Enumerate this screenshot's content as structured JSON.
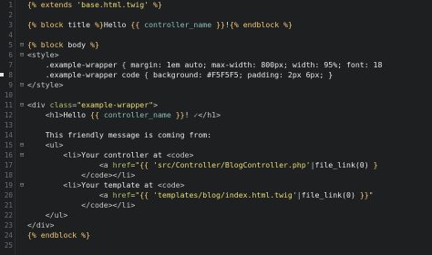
{
  "editor": {
    "lines": [
      {
        "n": "1",
        "fold": "",
        "marker": false,
        "tokens": [
          {
            "t": "{% ",
            "c": "t-bracket"
          },
          {
            "t": "extends ",
            "c": "t-keyword"
          },
          {
            "t": "'base.html.twig'",
            "c": "t-str"
          },
          {
            "t": " %}",
            "c": "t-bracket"
          }
        ]
      },
      {
        "n": "2",
        "fold": "",
        "marker": false,
        "tokens": []
      },
      {
        "n": "3",
        "fold": "",
        "marker": false,
        "tokens": [
          {
            "t": "{% ",
            "c": "t-bracket"
          },
          {
            "t": "block ",
            "c": "t-keyword"
          },
          {
            "t": "title",
            "c": "t-text"
          },
          {
            "t": " %}",
            "c": "t-bracket"
          },
          {
            "t": "Hello ",
            "c": "t-text"
          },
          {
            "t": "{{ ",
            "c": "t-bracket"
          },
          {
            "t": "controller_name",
            "c": "t-var"
          },
          {
            "t": " }}",
            "c": "t-bracket"
          },
          {
            "t": "!",
            "c": "t-text"
          },
          {
            "t": "{% ",
            "c": "t-bracket"
          },
          {
            "t": "endblock",
            "c": "t-keyword"
          },
          {
            "t": " %}",
            "c": "t-bracket"
          }
        ]
      },
      {
        "n": "4",
        "fold": "",
        "marker": false,
        "tokens": []
      },
      {
        "n": "5",
        "fold": "⊟",
        "marker": false,
        "tokens": [
          {
            "t": "{% ",
            "c": "t-bracket"
          },
          {
            "t": "block ",
            "c": "t-keyword"
          },
          {
            "t": "body",
            "c": "t-text"
          },
          {
            "t": " %}",
            "c": "t-bracket"
          }
        ]
      },
      {
        "n": "6",
        "fold": "⊟",
        "marker": false,
        "tokens": [
          {
            "t": "<style>",
            "c": "t-tag"
          }
        ]
      },
      {
        "n": "7",
        "fold": "",
        "marker": false,
        "tokens": [
          {
            "t": "    .example-wrapper ",
            "c": "t-sel"
          },
          {
            "t": "{ ",
            "c": "t-punc"
          },
          {
            "t": "margin: 1em auto; max-width: 800px; width: 95%; font: 18",
            "c": "t-prop"
          }
        ]
      },
      {
        "n": "8",
        "fold": "",
        "marker": true,
        "tokens": [
          {
            "t": "    .example-wrapper code ",
            "c": "t-sel"
          },
          {
            "t": "{ ",
            "c": "t-punc"
          },
          {
            "t": "background: #F5F5F5; padding: 2px 6px; }",
            "c": "t-prop"
          }
        ]
      },
      {
        "n": "9",
        "fold": "⊟",
        "marker": false,
        "tokens": [
          {
            "t": "</style>",
            "c": "t-tag"
          }
        ]
      },
      {
        "n": "10",
        "fold": "",
        "marker": false,
        "tokens": []
      },
      {
        "n": "11",
        "fold": "⊟",
        "marker": false,
        "tokens": [
          {
            "t": "<div ",
            "c": "t-tag"
          },
          {
            "t": "class",
            "c": "t-attr"
          },
          {
            "t": "=",
            "c": "t-punc"
          },
          {
            "t": "\"example-wrapper\"",
            "c": "t-str"
          },
          {
            "t": ">",
            "c": "t-tag"
          }
        ]
      },
      {
        "n": "12",
        "fold": "",
        "marker": false,
        "tokens": [
          {
            "t": "    <h1>",
            "c": "t-tag"
          },
          {
            "t": "Hello ",
            "c": "t-text"
          },
          {
            "t": "{{ ",
            "c": "t-bracket"
          },
          {
            "t": "controller_name",
            "c": "t-var"
          },
          {
            "t": " }}",
            "c": "t-bracket"
          },
          {
            "t": "! ",
            "c": "t-text"
          },
          {
            "t": "✓",
            "c": "t-cursor"
          },
          {
            "t": "</h1>",
            "c": "t-tag"
          }
        ]
      },
      {
        "n": "13",
        "fold": "",
        "marker": false,
        "tokens": []
      },
      {
        "n": "14",
        "fold": "",
        "marker": false,
        "tokens": [
          {
            "t": "    This friendly message is coming from:",
            "c": "t-text"
          }
        ]
      },
      {
        "n": "15",
        "fold": "⊟",
        "marker": false,
        "tokens": [
          {
            "t": "    <ul>",
            "c": "t-tag"
          }
        ]
      },
      {
        "n": "16",
        "fold": "⊟",
        "marker": false,
        "tokens": [
          {
            "t": "        <li>",
            "c": "t-tag"
          },
          {
            "t": "Your controller at ",
            "c": "t-text"
          },
          {
            "t": "<code>",
            "c": "t-tag"
          }
        ]
      },
      {
        "n": "17",
        "fold": "",
        "marker": false,
        "tokens": [
          {
            "t": "                <a ",
            "c": "t-tag"
          },
          {
            "t": "href",
            "c": "t-attr"
          },
          {
            "t": "=\"",
            "c": "t-str"
          },
          {
            "t": "{{ ",
            "c": "t-bracket"
          },
          {
            "t": "'src/Controller/BlogController.php'",
            "c": "t-str"
          },
          {
            "t": "|",
            "c": "t-punc"
          },
          {
            "t": "file_link(0)",
            "c": "t-text"
          },
          {
            "t": " }",
            "c": "t-bracket"
          }
        ]
      },
      {
        "n": "18",
        "fold": "",
        "marker": false,
        "tokens": [
          {
            "t": "            </code>",
            "c": "t-tag"
          },
          {
            "t": "</li>",
            "c": "t-tag"
          }
        ]
      },
      {
        "n": "19",
        "fold": "⊟",
        "marker": false,
        "tokens": [
          {
            "t": "        <li>",
            "c": "t-tag"
          },
          {
            "t": "Your template at ",
            "c": "t-text"
          },
          {
            "t": "<code>",
            "c": "t-tag"
          }
        ]
      },
      {
        "n": "20",
        "fold": "",
        "marker": false,
        "tokens": [
          {
            "t": "                <a ",
            "c": "t-tag"
          },
          {
            "t": "href",
            "c": "t-attr"
          },
          {
            "t": "=\"",
            "c": "t-str"
          },
          {
            "t": "{{ ",
            "c": "t-bracket"
          },
          {
            "t": "'templates/blog/index.html.twig'",
            "c": "t-str"
          },
          {
            "t": "|",
            "c": "t-punc"
          },
          {
            "t": "file_link(0)",
            "c": "t-text"
          },
          {
            "t": " }}\"",
            "c": "t-bracket"
          }
        ]
      },
      {
        "n": "21",
        "fold": "",
        "marker": false,
        "tokens": [
          {
            "t": "            </code>",
            "c": "t-tag"
          },
          {
            "t": "</li>",
            "c": "t-tag"
          }
        ]
      },
      {
        "n": "22",
        "fold": "",
        "marker": false,
        "tokens": [
          {
            "t": "    </ul>",
            "c": "t-tag"
          }
        ]
      },
      {
        "n": "23",
        "fold": "",
        "marker": false,
        "tokens": [
          {
            "t": "</div>",
            "c": "t-tag"
          }
        ]
      },
      {
        "n": "24",
        "fold": "",
        "marker": false,
        "tokens": [
          {
            "t": "{% ",
            "c": "t-bracket"
          },
          {
            "t": "endblock",
            "c": "t-keyword"
          },
          {
            "t": " %}",
            "c": "t-bracket"
          }
        ]
      },
      {
        "n": "25",
        "fold": "",
        "marker": false,
        "tokens": []
      }
    ]
  }
}
